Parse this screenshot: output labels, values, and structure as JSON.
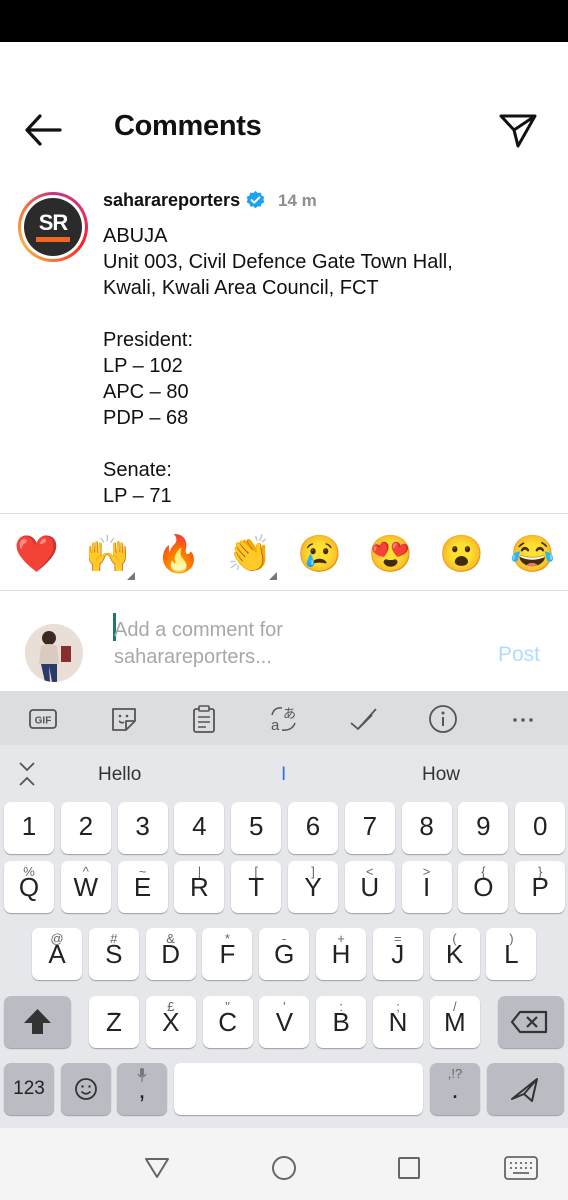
{
  "header": {
    "title": "Comments"
  },
  "post": {
    "username": "saharareporters",
    "time": "14 m",
    "lines": [
      "ABUJA",
      "Unit 003, Civil Defence Gate Town Hall,",
      "Kwali, Kwali Area Council, FCT",
      "",
      "President:",
      "LP – 102",
      "APC – 80",
      "PDP – 68",
      "",
      "Senate:",
      "LP – 71"
    ]
  },
  "avatar_text": "SR",
  "reactions": [
    "❤️",
    "🙌",
    "🔥",
    "👏",
    "😢",
    "😍",
    "😮",
    "😂"
  ],
  "compose": {
    "placeholder": "Add a comment for saharareporters...",
    "post_label": "Post"
  },
  "keyboard": {
    "toolbar": [
      "gif-icon",
      "sticker-icon",
      "clipboard-icon",
      "translate-icon",
      "handwriting-icon",
      "info-icon",
      "more-icon"
    ],
    "suggestions": [
      "Hello",
      "I",
      "How"
    ],
    "numbers": [
      "1",
      "2",
      "3",
      "4",
      "5",
      "6",
      "7",
      "8",
      "9",
      "0"
    ],
    "row1": [
      {
        "k": "Q",
        "s": "%"
      },
      {
        "k": "W",
        "s": "^"
      },
      {
        "k": "E",
        "s": "~"
      },
      {
        "k": "R",
        "s": "|"
      },
      {
        "k": "T",
        "s": "["
      },
      {
        "k": "Y",
        "s": "]"
      },
      {
        "k": "U",
        "s": "<"
      },
      {
        "k": "I",
        "s": ">"
      },
      {
        "k": "O",
        "s": "{"
      },
      {
        "k": "P",
        "s": "}"
      }
    ],
    "row2": [
      {
        "k": "A",
        "s": "@"
      },
      {
        "k": "S",
        "s": "#"
      },
      {
        "k": "D",
        "s": "&"
      },
      {
        "k": "F",
        "s": "*"
      },
      {
        "k": "G",
        "s": "-"
      },
      {
        "k": "H",
        "s": "+"
      },
      {
        "k": "J",
        "s": "="
      },
      {
        "k": "K",
        "s": "("
      },
      {
        "k": "L",
        "s": ")"
      }
    ],
    "row3": [
      {
        "k": "Z",
        "s": "_"
      },
      {
        "k": "X",
        "s": "£"
      },
      {
        "k": "C",
        "s": "\""
      },
      {
        "k": "V",
        "s": "'"
      },
      {
        "k": "B",
        "s": ":"
      },
      {
        "k": "N",
        "s": ";"
      },
      {
        "k": "M",
        "s": "/"
      }
    ],
    "bottom": {
      "sym": "123",
      "comma": ",",
      "period": ".",
      "period_sub": ",!?"
    }
  }
}
